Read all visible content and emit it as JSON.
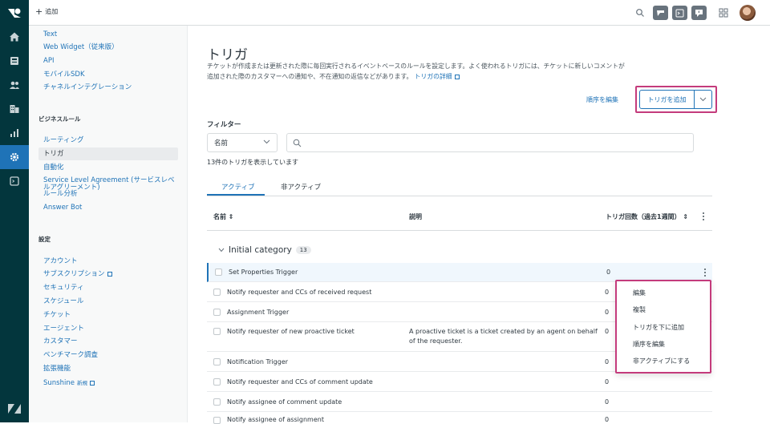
{
  "topbar": {
    "add_label": "追加"
  },
  "sidebar": {
    "channel_items": [
      {
        "label": "Text"
      },
      {
        "label": "Web Widget（従来版）"
      },
      {
        "label": "API"
      },
      {
        "label": "モバイルSDK"
      },
      {
        "label": "チャネルインテグレーション"
      }
    ],
    "business_rules_heading": "ビジネスルール",
    "business_rules_items": [
      {
        "label": "ルーティング"
      },
      {
        "label": "トリガ"
      },
      {
        "label": "自動化"
      },
      {
        "label": "Service Level Agreement (サービスレベルアグリーメント)"
      },
      {
        "label": "ルール分析"
      },
      {
        "label": "Answer Bot"
      }
    ],
    "settings_heading": "設定",
    "settings_items": [
      {
        "label": "アカウント"
      },
      {
        "label": "サブスクリプション"
      },
      {
        "label": "セキュリティ"
      },
      {
        "label": "スケジュール"
      },
      {
        "label": "チケット"
      },
      {
        "label": "エージェント"
      },
      {
        "label": "カスタマー"
      },
      {
        "label": "ベンチマーク調査"
      },
      {
        "label": "拡張機能"
      },
      {
        "label": "Sunshine"
      }
    ],
    "new_badge": "新規"
  },
  "page": {
    "title": "トリガ",
    "description": "チケットが作成または更新された際に毎回実行されるイベントベースのルールを設定します。よく使われるトリガには、チケットに新しいコメントが追加された際のカスタマーへの通知や、不在通知の返信などがあります。",
    "details_link": "トリガの詳細",
    "reorder_link": "順序を編集",
    "add_trigger_label": "トリガを追加",
    "filter_label": "フィルター",
    "filter_select_value": "名前",
    "search_placeholder": "",
    "count_text": "13件のトリガを表示しています",
    "tabs": [
      {
        "label": "アクティブ"
      },
      {
        "label": "非アクティブ"
      }
    ],
    "columns": {
      "name": "名前",
      "description": "説明",
      "count": "トリガ回数（過去1週間）"
    },
    "category": {
      "name": "Initial category",
      "count": "13"
    },
    "rows": [
      {
        "name": "Set Properties Trigger",
        "description": "",
        "count": "0"
      },
      {
        "name": "Notify requester and CCs of received request",
        "description": "",
        "count": "0"
      },
      {
        "name": "Assignment Trigger",
        "description": "",
        "count": "0"
      },
      {
        "name": "Notify requester of new proactive ticket",
        "description": "A proactive ticket is a ticket created by an agent on behalf of the requester.",
        "count": "0"
      },
      {
        "name": "Notification Trigger",
        "description": "",
        "count": "0"
      },
      {
        "name": "Notify requester and CCs of comment update",
        "description": "",
        "count": "0"
      },
      {
        "name": "Notify assignee of comment update",
        "description": "",
        "count": "0"
      },
      {
        "name": "Notify assignee of assignment",
        "description": "",
        "count": "0"
      }
    ]
  },
  "context_menu": {
    "items": [
      {
        "label": "編集"
      },
      {
        "label": "複製"
      },
      {
        "label": "トリガを下に追加"
      },
      {
        "label": "順序を編集"
      },
      {
        "label": "非アクティブにする"
      }
    ]
  },
  "colors": {
    "rail": "#03363d",
    "accent": "#1f73b7",
    "highlight": "#c43b7c"
  }
}
